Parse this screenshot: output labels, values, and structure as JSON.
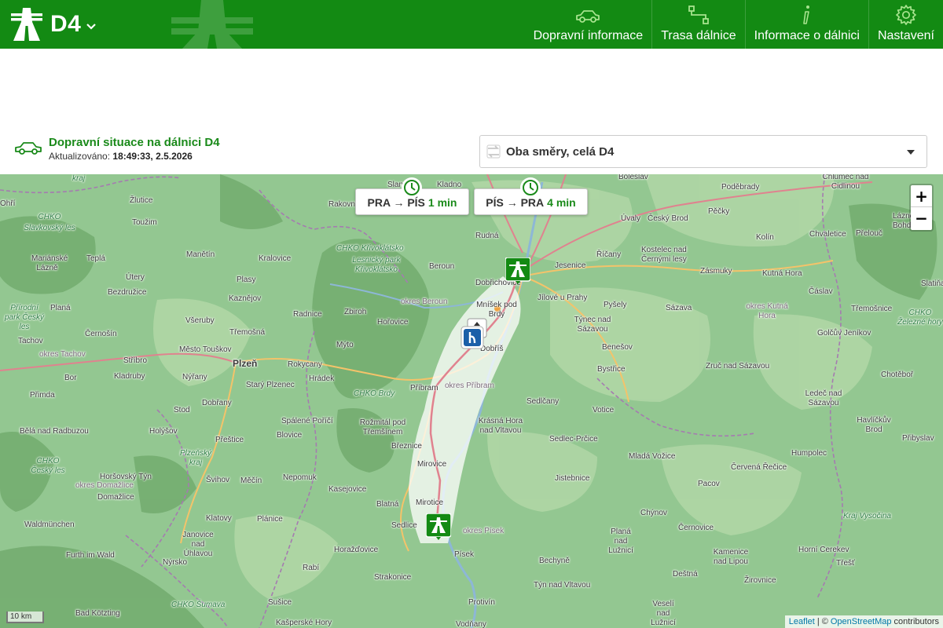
{
  "header": {
    "title": "D4",
    "nav": [
      {
        "label": "Dopravní informace",
        "icon": "car-icon"
      },
      {
        "label": "Trasa dálnice",
        "icon": "route-icon"
      },
      {
        "label": "Informace o dálnici",
        "icon": "info-icon"
      },
      {
        "label": "Nastavení",
        "icon": "gear-icon"
      }
    ]
  },
  "status": {
    "title": "Dopravní situace na dálnici D4",
    "updated_label": "Aktualizováno:",
    "updated_value": "18:49:33, 2.5.2026",
    "direction_value": "Oba směry, celá D4"
  },
  "map": {
    "travel_times": [
      {
        "route": "PRA → PÍS",
        "time": "1 min"
      },
      {
        "route": "PÍS → PRA",
        "time": "4 min"
      }
    ],
    "zoom_in": "+",
    "zoom_out": "−",
    "scale": "10 km",
    "attribution": {
      "leaflet": "Leaflet",
      "sep": "| ©",
      "osm": "OpenStreetMap",
      "suffix": "contributors"
    },
    "places": [
      "Slaný",
      "Kladno",
      "Boleslav",
      "Poděbrady",
      "Chlumec nad Cidlinou",
      "Úvaly",
      "Český Brod",
      "Pěčky",
      "Lázně Bohdaneč",
      "Rakovník",
      "Rudná",
      "Jesenice",
      "Říčany",
      "Kolín",
      "Chvaletice",
      "Přelouč",
      "Beroun",
      "Dobřichovice",
      "Kostelec nad Černými lesy",
      "Zásmuky",
      "Kutná Hora",
      "Čáslav",
      "Slatiňany",
      "Jílové u Prahy",
      "Pyšely",
      "Sázava",
      "Třemošnice",
      "Týnec nad Sázavou",
      "Golčův Jeníkov",
      "Benešov",
      "Bystřice",
      "Zruč nad Sázavou",
      "Chotěboř",
      "Ledeč nad Sázavou",
      "Sedlčany",
      "Votice",
      "Havlíčkův Brod",
      "Přibyslav",
      "Krásná Hora nad Vltavou",
      "Sedlec-Prčice",
      "Mladá Vožice",
      "Humpolec",
      "Jistebnice",
      "Červená Řečice",
      "Pacov",
      "Chýnov",
      "Černovice",
      "Kamenice nad Lipou",
      "Horní Cerekev",
      "Třešť",
      "Bechyně",
      "Žirovnice",
      "Týn nad Vltavou",
      "Deštná",
      "Veselí nad Lužnicí",
      "Planá nad Lužnicí",
      "Protivín",
      "Vodňany",
      "Písek",
      "Mirotice",
      "Sedlice",
      "Mirovice",
      "Březnice",
      "Blatná",
      "Rožmitál pod Třemšínem",
      "Příbram",
      "Dobříš",
      "Mníšek pod Brdy",
      "Hořovice",
      "Zbiroh",
      "Radnice",
      "Mýto",
      "Hrádek",
      "Rokycany",
      "Starý Plzenec",
      "Plzeň",
      "Kralovice",
      "Manětín",
      "Plasy",
      "Kaznějov",
      "Třemošná",
      "Všeruby",
      "Město Touškov",
      "Nýřany",
      "Stříbro",
      "Kladruby",
      "Tachov",
      "Bor",
      "Černošín",
      "Planá",
      "Přimda",
      "Stod",
      "Dobřany",
      "Bělá nad Radbuzou",
      "Holýšov",
      "Přeštice",
      "Spálené Poříčí",
      "Blovice",
      "Nepomuk",
      "Kasejovice",
      "Horšovský Týn",
      "Domažlice",
      "Švihov",
      "Měčín",
      "Klatovy",
      "Plánice",
      "Horažďovice",
      "Strakonice",
      "Nýrsko",
      "Janovice nad Úhlavou",
      "Rabí",
      "Sušice",
      "Waldmünchen",
      "Furth im Wald",
      "Bad Kötzting",
      "Kašperské Hory",
      "Teplá",
      "Mariánské Lázně",
      "Útery",
      "Bezdružice",
      "Toužim",
      "Žlutice",
      "Lesnický park Křivoklátsko",
      "CHKO Křivoklátsko",
      "CHKO Brdy",
      "CHKO Slavkovský les",
      "CHKO Český les",
      "CHKO Šumava",
      "Plzeňský kraj",
      "Kraj Vysočina",
      "Přírodní park Český les",
      "CHKO Železné hory",
      "okres Beroun",
      "okres Příbram",
      "okres Písek",
      "okres Tachov",
      "okres Domažlice",
      "okres Kutná Hora",
      "Ohří",
      "kraj"
    ]
  }
}
